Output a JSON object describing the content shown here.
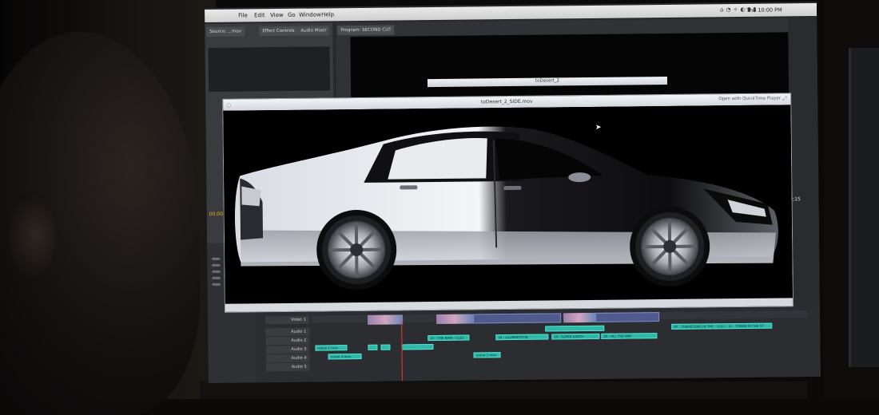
{
  "menubar": {
    "items": [
      "File",
      "Edit",
      "View",
      "Go",
      "Window",
      "Help"
    ],
    "clock": "Thu 10:00 PM"
  },
  "panels": {
    "source_tab": "Source: ...mov",
    "effects_tab": "Effect Controls",
    "audio_tab": "Audio Mixer",
    "program_tab": "Program: SECOND CUT",
    "source_timecode": "00;00",
    "program_timecode": "20;15"
  },
  "quicktime": {
    "back_window_title": "toDesert_2",
    "title": "toDesert_2_SIDE.mov",
    "open_button": "Open with QuickTime Player"
  },
  "timeline": {
    "tracks": [
      "Video 1",
      "Audio 1",
      "Audio 2",
      "Audio 3",
      "Audio 4",
      "Audio 5"
    ],
    "audio_clips": [
      "07 - THEMESONG IN THE - 1122 - 11 - TOWER IN THE ST",
      "14 - THE RAIN - 1122",
      "18 - ILLUMINATION",
      "19 - SUPER EARTH",
      "20 - ALL THE WAY",
      "scene 1.mov",
      "scene 3.mov",
      "scene 1.mov"
    ]
  },
  "colors": {
    "audio_clip": "#2fb8a9",
    "video_clip": "#4e5b8c",
    "playhead": "#e83b2a",
    "timecode": "#e8b21f"
  }
}
